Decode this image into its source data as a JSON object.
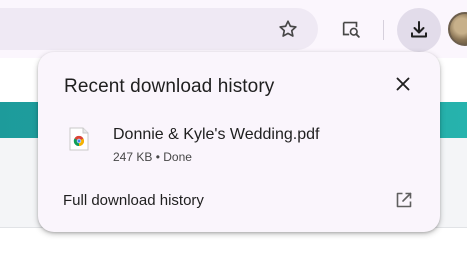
{
  "bubble": {
    "title": "Recent download history",
    "items": [
      {
        "file_name": "Donnie & Kyle's Wedding.pdf",
        "size": "247 KB",
        "status": "Done",
        "meta_separator": " • ",
        "icon": "pdf-file-icon"
      }
    ],
    "footer_label": "Full download history"
  },
  "icons": {
    "star": "star-icon",
    "lens": "page-search-icon",
    "download": "download-icon",
    "close": "close-icon",
    "open_external": "open-in-new-icon"
  },
  "colors": {
    "toolbar_bg": "#fbf6fd",
    "omnibox_bg": "#efe9f4",
    "bubble_bg": "#faf5fc",
    "accent_teal": "#1d9b9b"
  }
}
